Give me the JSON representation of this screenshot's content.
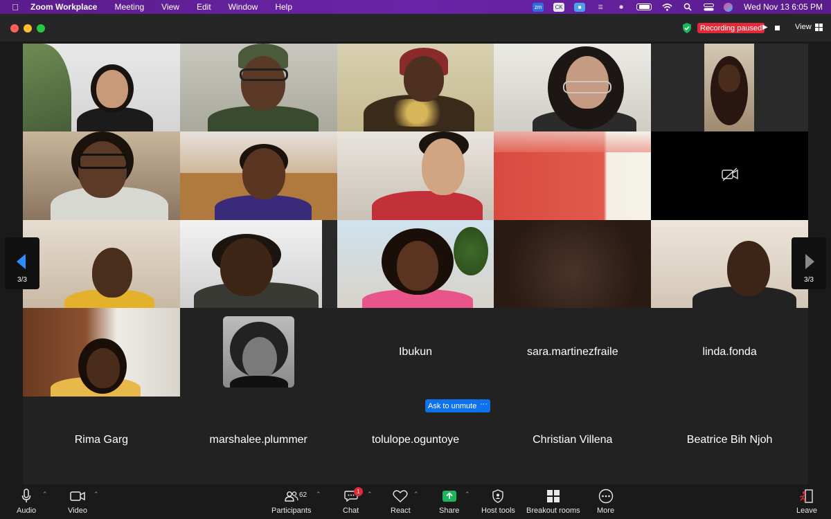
{
  "menubar": {
    "app_name": "Zoom Workplace",
    "items": [
      "Meeting",
      "View",
      "Edit",
      "Window",
      "Help"
    ],
    "clock": "Wed Nov 13  6:05 PM",
    "status_icons": [
      "zoom-icon",
      "ck-icon",
      "app-icon",
      "stack-icon",
      "bluetooth-icon",
      "battery-icon",
      "wifi-icon",
      "search-icon",
      "control-center-icon",
      "siri-icon"
    ]
  },
  "titlebar": {
    "recording_status": "Recording paused",
    "view_label": "View"
  },
  "gallery": {
    "page_indicator_left": "3/3",
    "page_indicator_right": "3/3",
    "name_tiles": [
      {
        "name": "Ibukun"
      },
      {
        "name": "sara.martinezfraile"
      },
      {
        "name": "linda.fonda"
      },
      {
        "name": "Rima Garg"
      },
      {
        "name": "marshalee.plummer"
      },
      {
        "name": "tolulope.oguntoye"
      },
      {
        "name": "Christian Villena"
      },
      {
        "name": "Beatrice Bih Njoh"
      }
    ],
    "ask_to_unmute_label": "Ask to unmute",
    "more_label": "···"
  },
  "toolbar": {
    "audio_label": "Audio",
    "video_label": "Video",
    "participants_label": "Participants",
    "participants_count": "62",
    "chat_label": "Chat",
    "chat_badge": "1",
    "react_label": "React",
    "share_label": "Share",
    "host_tools_label": "Host tools",
    "breakout_label": "Breakout rooms",
    "more_label": "More",
    "leave_label": "Leave"
  },
  "colors": {
    "menubar_purple": "#5b1d8a",
    "recording_red": "#e02a37",
    "zoom_blue": "#0e72ed",
    "share_green": "#1bb55c",
    "pager_blue": "#2d8cff"
  }
}
